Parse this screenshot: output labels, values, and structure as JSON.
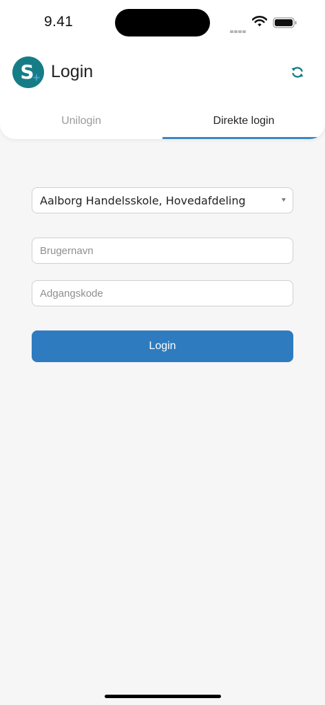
{
  "status_bar": {
    "time": "9.41",
    "signal_icon": "signal-dots-icon",
    "wifi_icon": "wifi-icon",
    "battery_icon": "battery-icon"
  },
  "app_bar": {
    "logo_letter": "S",
    "logo_plus": "+",
    "title": "Login",
    "refresh_icon": "refresh-icon",
    "accent_color": "#167d87"
  },
  "tabs": [
    {
      "label": "Unilogin",
      "active": false
    },
    {
      "label": "Direkte login",
      "active": true
    }
  ],
  "form": {
    "school_select": {
      "value": "Aalborg Handelsskole, Hovedafdeling"
    },
    "username": {
      "value": "",
      "placeholder": "Brugernavn"
    },
    "password": {
      "value": "",
      "placeholder": "Adgangskode"
    },
    "login_button_label": "Login",
    "button_color": "#2e7cbf"
  }
}
